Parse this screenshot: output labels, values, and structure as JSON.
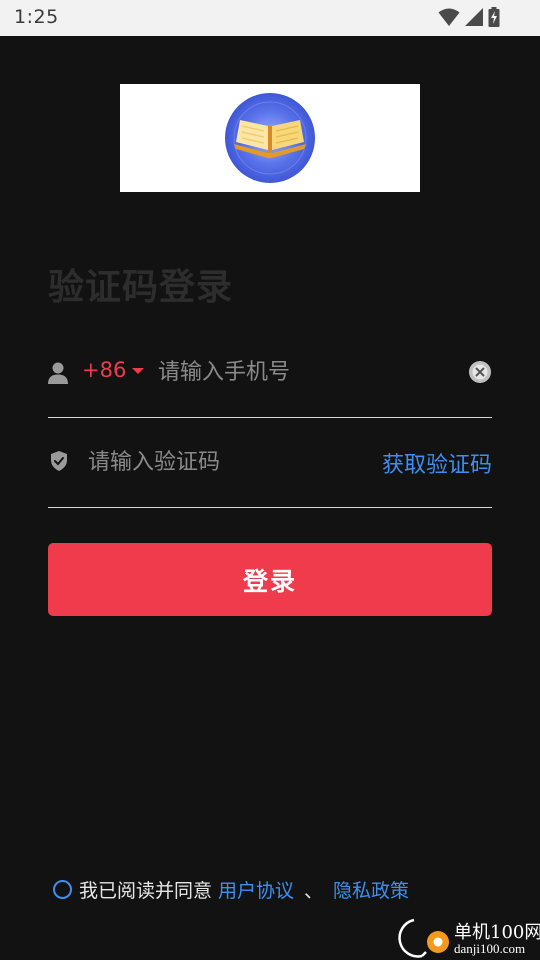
{
  "status_bar": {
    "time": "1:25",
    "icons": [
      "wifi-icon",
      "signal-icon",
      "battery-charging-icon"
    ]
  },
  "logo": {
    "icon": "open-book-icon",
    "colors": {
      "circle": "#4b63e0",
      "book": "#f2c14e"
    }
  },
  "title": "验证码登录",
  "phone": {
    "user_icon": "user-icon",
    "country_code": "+86",
    "placeholder": "请输入手机号",
    "value": "",
    "clear_icon": "clear-icon"
  },
  "code": {
    "shield_icon": "shield-icon",
    "placeholder": "请输入验证码",
    "value": "",
    "get_code_label": "获取验证码"
  },
  "login_button": "登录",
  "agreement": {
    "prefix": "我已阅读并同意",
    "user_agreement": "用户协议",
    "separator": "、",
    "privacy_policy": "隐私政策"
  },
  "watermark": {
    "title": "单机100网",
    "url": "danji100.com"
  },
  "colors": {
    "background": "#121212",
    "accent_red": "#ef3b4b",
    "link_blue": "#3d8ff0",
    "status_bar": "#f2f2f2"
  }
}
